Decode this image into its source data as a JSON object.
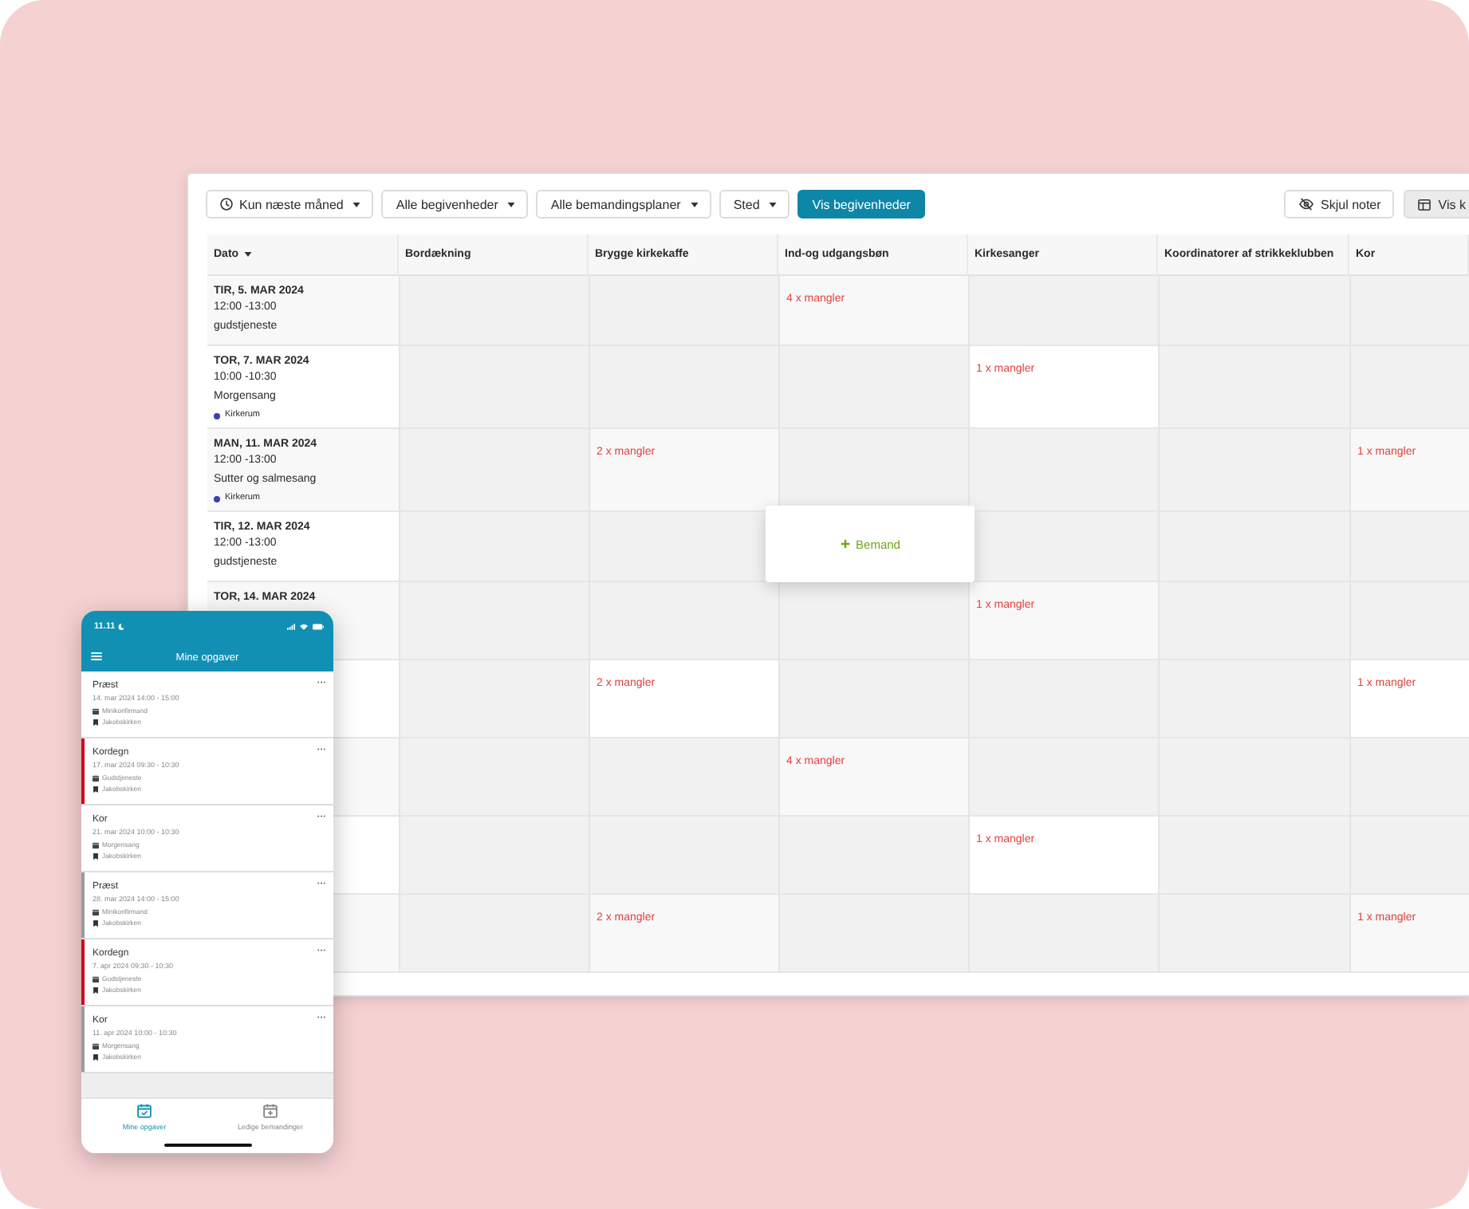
{
  "toolbar": {
    "filters": [
      {
        "label": "Kun næste måned",
        "kind": "period"
      },
      {
        "label": "Alle begivenheder",
        "kind": "plain"
      },
      {
        "label": "Alle bemandingsplaner",
        "kind": "plain"
      },
      {
        "label": "Sted",
        "kind": "plain"
      }
    ],
    "apply_button": "Vis begivenheder",
    "notes_button": "Skjul noter",
    "view_button": "Vis k"
  },
  "table": {
    "columns": [
      {
        "label": "Dato",
        "sorted": true
      },
      {
        "label": "Bordækning",
        "sorted": false
      },
      {
        "label": "Brygge kirkekaffe",
        "sorted": false
      },
      {
        "label": "Ind-og udgangsbøn",
        "sorted": false
      },
      {
        "label": "Kirkesanger",
        "sorted": false
      },
      {
        "label": "Koordinatorer af strikkeklubben",
        "sorted": false
      },
      {
        "label": "Kor",
        "sorted": false
      }
    ],
    "rows": [
      {
        "cells": [
          {
            "kind": "event",
            "date": "TIR, 5. MAR 2024",
            "time": "12:00 -13:00",
            "title": "gudstjeneste"
          },
          {
            "kind": "empty"
          },
          {
            "kind": "empty"
          },
          {
            "kind": "need",
            "text": "4 x mangler"
          },
          {
            "kind": "empty"
          },
          {
            "kind": "empty"
          },
          {
            "kind": "empty"
          }
        ]
      },
      {
        "cells": [
          {
            "kind": "event",
            "date": "TOR, 7. MAR 2024",
            "time": "10:00 -10:30",
            "title": "Morgensang",
            "location": "Kirkerum"
          },
          {
            "kind": "empty"
          },
          {
            "kind": "empty"
          },
          {
            "kind": "empty"
          },
          {
            "kind": "need",
            "text": "1 x mangler"
          },
          {
            "kind": "empty"
          },
          {
            "kind": "empty"
          }
        ]
      },
      {
        "cells": [
          {
            "kind": "event",
            "date": "MAN, 11. MAR 2024",
            "time": "12:00 -13:00",
            "title": "Sutter og salmesang",
            "location": "Kirkerum"
          },
          {
            "kind": "empty"
          },
          {
            "kind": "need",
            "text": "2 x mangler"
          },
          {
            "kind": "empty"
          },
          {
            "kind": "empty"
          },
          {
            "kind": "empty"
          },
          {
            "kind": "need",
            "text": "1 x mangler"
          }
        ]
      },
      {
        "cells": [
          {
            "kind": "event",
            "date": "TIR, 12. MAR 2024",
            "time": "12:00 -13:00",
            "title": "gudstjeneste"
          },
          {
            "kind": "empty"
          },
          {
            "kind": "empty"
          },
          {
            "kind": "action",
            "text": "Bemand"
          },
          {
            "kind": "empty"
          },
          {
            "kind": "empty"
          },
          {
            "kind": "empty"
          }
        ]
      },
      {
        "cells": [
          {
            "kind": "event",
            "date": "TOR, 14. MAR 2024"
          },
          {
            "kind": "empty"
          },
          {
            "kind": "empty"
          },
          {
            "kind": "empty"
          },
          {
            "kind": "need",
            "text": "1 x mangler"
          },
          {
            "kind": "empty"
          },
          {
            "kind": "empty"
          }
        ]
      },
      {
        "cells": [
          {
            "kind": "event"
          },
          {
            "kind": "empty"
          },
          {
            "kind": "need",
            "text": "2 x mangler"
          },
          {
            "kind": "empty"
          },
          {
            "kind": "empty"
          },
          {
            "kind": "empty"
          },
          {
            "kind": "need",
            "text": "1 x mangler"
          }
        ]
      },
      {
        "cells": [
          {
            "kind": "event"
          },
          {
            "kind": "empty"
          },
          {
            "kind": "empty"
          },
          {
            "kind": "need",
            "text": "4 x mangler"
          },
          {
            "kind": "empty"
          },
          {
            "kind": "empty"
          },
          {
            "kind": "empty"
          }
        ]
      },
      {
        "cells": [
          {
            "kind": "event"
          },
          {
            "kind": "empty"
          },
          {
            "kind": "empty"
          },
          {
            "kind": "empty"
          },
          {
            "kind": "need",
            "text": "1 x mangler"
          },
          {
            "kind": "empty"
          },
          {
            "kind": "empty"
          }
        ]
      },
      {
        "cells": [
          {
            "kind": "event"
          },
          {
            "kind": "empty"
          },
          {
            "kind": "need",
            "text": "2 x mangler"
          },
          {
            "kind": "empty"
          },
          {
            "kind": "empty"
          },
          {
            "kind": "empty"
          },
          {
            "kind": "need",
            "text": "1 x mangler"
          }
        ]
      }
    ]
  },
  "phone": {
    "time": "11.11",
    "title": "Mine opgaver",
    "tasks": [
      {
        "role": "Præst",
        "when": "14. mar 2024 14:00 - 15:00",
        "event": "Minikonfirmand",
        "place": "Jakobskirken"
      },
      {
        "role": "Kordegn",
        "when": "17. mar 2024 09:30 - 10:30",
        "event": "Gudstjeneste",
        "place": "Jakobskirken",
        "color": "#d0021b"
      },
      {
        "role": "Kor",
        "when": "21. mar 2024 10:00 - 10:30",
        "event": "Morgensang",
        "place": "Jakobskirken"
      },
      {
        "role": "Præst",
        "when": "28. mar 2024 14:00 - 15:00",
        "event": "Minikonfirmand",
        "place": "Jakobskirken",
        "color": "#9b9b9b"
      },
      {
        "role": "Kordegn",
        "when": "7. apr 2024 09:30 - 10:30",
        "event": "Gudstjeneste",
        "place": "Jakobskirken",
        "color": "#d0021b"
      },
      {
        "role": "Kor",
        "when": "11. apr 2024 10:00 - 10:30",
        "event": "Morgensang",
        "place": "Jakobskirken",
        "color": "#9b9b9b"
      }
    ],
    "tabs": [
      {
        "label": "Mine opgaver",
        "kind": "tasks",
        "selected": true
      },
      {
        "label": "Ledige bemandinger",
        "kind": "open",
        "selected": false
      }
    ]
  }
}
